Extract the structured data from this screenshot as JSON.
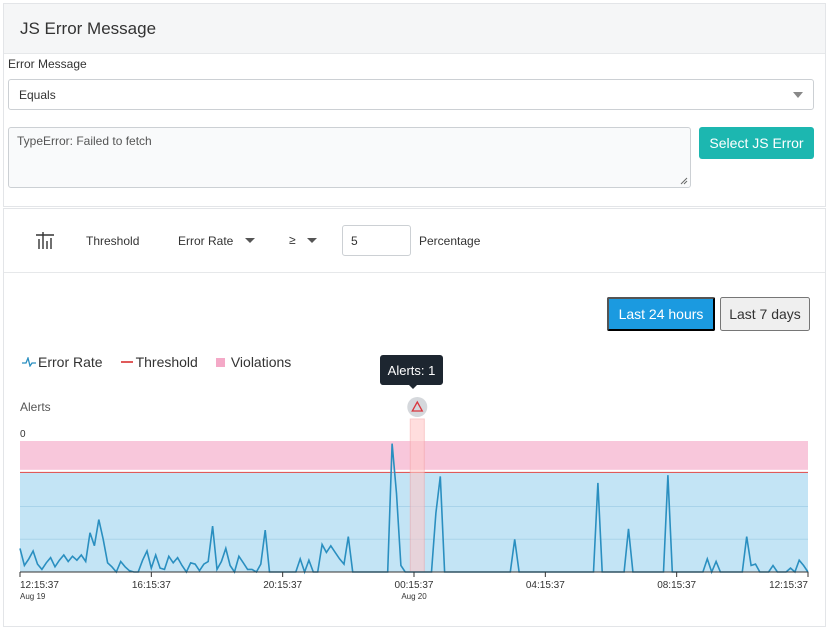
{
  "panel": {
    "title": "JS Error Message"
  },
  "filter": {
    "label": "Error Message",
    "operator_value": "Equals",
    "message_value": "TypeError: Failed to fetch",
    "select_button": "Select JS Error"
  },
  "rule": {
    "threshold_label": "Threshold",
    "metric_value": "Error Rate",
    "operator_value": "≥",
    "threshold_value": "5",
    "unit_label": "Percentage"
  },
  "time_range": {
    "active": "Last 24 hours",
    "other": "Last 7 days"
  },
  "legend": {
    "error_rate": "Error Rate",
    "threshold": "Threshold",
    "violations": "Violations"
  },
  "tooltip": {
    "text": "Alerts: 1"
  },
  "alerts_label": "Alerts",
  "colors": {
    "accent_teal": "#1cb7b0",
    "accent_blue": "#1b9ae0",
    "series": "#2a8fc0",
    "threshold": "#e05a5a",
    "violation": "#f4a9c7",
    "fill": "#c3e4f5"
  },
  "chart_data": {
    "type": "line",
    "y_top_label": "0",
    "x_ticks": [
      {
        "time": "12:15:37",
        "date": "Aug 19"
      },
      {
        "time": "16:15:37",
        "date": ""
      },
      {
        "time": "20:15:37",
        "date": ""
      },
      {
        "time": "00:15:37",
        "date": "Aug 20"
      },
      {
        "time": "04:15:37",
        "date": ""
      },
      {
        "time": "08:15:37",
        "date": ""
      },
      {
        "time": "12:15:37",
        "date": ""
      }
    ],
    "violation_band": {
      "min": 0.78,
      "max": 1.0
    },
    "threshold_level": 0.76,
    "alert_hour": 12.1,
    "values": [
      0.18,
      0.05,
      0.1,
      0.16,
      0.06,
      0.02,
      0.07,
      0.11,
      0.04,
      0.09,
      0.13,
      0.08,
      0.12,
      0.09,
      0.13,
      0.08,
      0.3,
      0.2,
      0.4,
      0.25,
      0.07,
      0.04,
      0.0,
      0.08,
      0.04,
      0.01,
      0.0,
      0.0,
      0.09,
      0.16,
      0.03,
      0.13,
      0.03,
      0.02,
      0.12,
      0.07,
      0.11,
      0.05,
      0.0,
      0.07,
      0.06,
      0.01,
      0.06,
      0.08,
      0.35,
      0.02,
      0.08,
      0.18,
      0.05,
      0.0,
      0.12,
      0.07,
      0.02,
      0.02,
      0.0,
      0.06,
      0.32,
      0.0,
      0.0,
      0.0,
      0.0,
      0.0,
      0.0,
      0.0,
      0.1,
      0.0,
      0.09,
      0.0,
      0.0,
      0.21,
      0.15,
      0.2,
      0.15,
      0.1,
      0.06,
      0.27,
      0.0,
      0.0,
      0.0,
      0.0,
      0.0,
      0.0,
      0.0,
      0.0,
      0.0,
      0.98,
      0.6,
      0.05,
      0.0,
      0.0,
      0.0,
      0.0,
      0.0,
      0.0,
      0.0,
      0.45,
      0.73,
      0.0,
      0.0,
      0.0,
      0.0,
      0.0,
      0.0,
      0.0,
      0.0,
      0.0,
      0.0,
      0.0,
      0.0,
      0.0,
      0.0,
      0.0,
      0.0,
      0.25,
      0.0,
      0.0,
      0.0,
      0.0,
      0.0,
      0.0,
      0.0,
      0.0,
      0.0,
      0.0,
      0.0,
      0.0,
      0.0,
      0.0,
      0.0,
      0.0,
      0.0,
      0.0,
      0.68,
      0.0,
      0.0,
      0.0,
      0.0,
      0.0,
      0.0,
      0.33,
      0.0,
      0.0,
      0.0,
      0.0,
      0.0,
      0.0,
      0.0,
      0.0,
      0.74,
      0.0,
      0.0,
      0.0,
      0.0,
      0.0,
      0.0,
      0.0,
      0.0,
      0.1,
      0.0,
      0.08,
      0.0,
      0.0,
      0.0,
      0.0,
      0.0,
      0.0,
      0.27,
      0.05,
      0.06,
      0.0,
      0.0,
      0.0,
      0.05,
      0.0,
      0.0,
      0.0,
      0.03,
      0.0,
      0.09,
      0.05,
      0.0
    ]
  }
}
